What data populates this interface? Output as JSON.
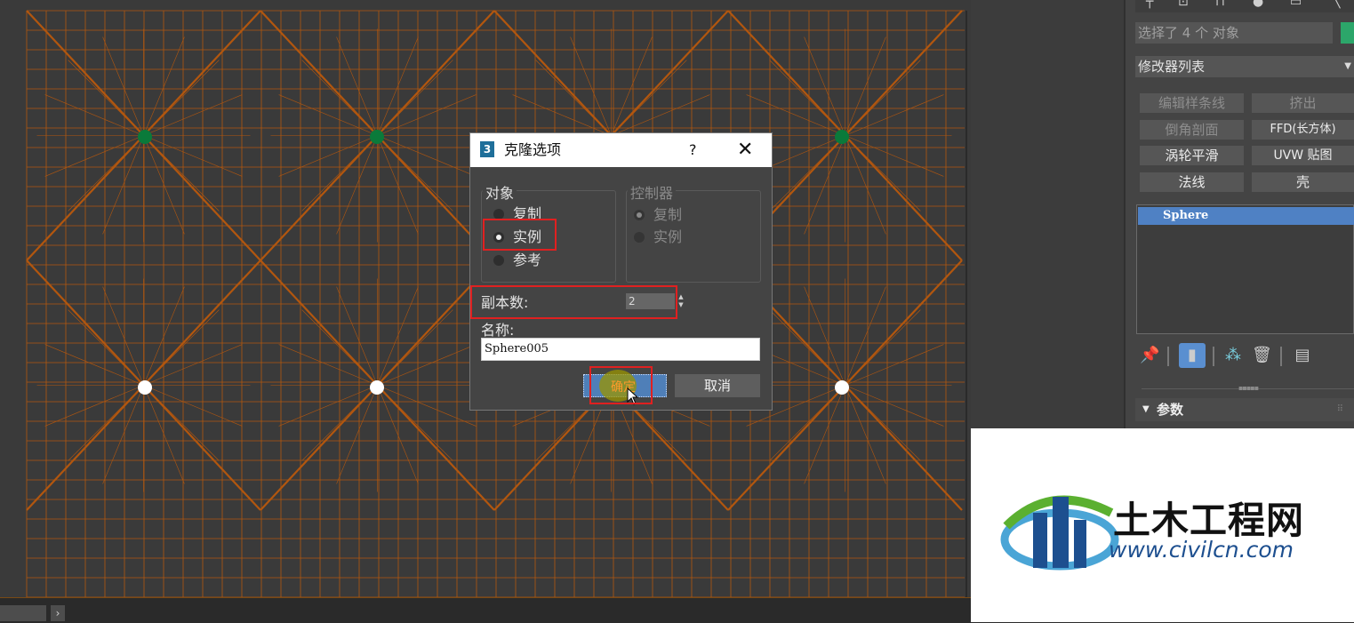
{
  "dialog": {
    "app_icon_text": "3",
    "title": "克隆选项",
    "help": "?",
    "close": "✕",
    "object_group": {
      "label": "对象",
      "options": [
        "复制",
        "实例",
        "参考"
      ],
      "selected": "实例"
    },
    "controller_group": {
      "label": "控制器",
      "options": [
        "复制",
        "实例"
      ],
      "selected": "复制"
    },
    "copies_label": "副本数:",
    "copies_value": "2",
    "name_label": "名称:",
    "name_value": "Sphere005",
    "ok_label": "确定",
    "cancel_label": "取消"
  },
  "panel": {
    "selection_text": "选择了 4 个 对象",
    "selection_color": "#2ca66a",
    "modifier_list": "修改器列表",
    "modifier_buttons": [
      "编辑样条线",
      "挤出",
      "倒角剖面",
      "FFD(长方体)",
      "涡轮平滑",
      "UVW 贴图",
      "法线",
      "壳"
    ],
    "stack_item": "Sphere",
    "rollout_title": "参数"
  },
  "toolbar_icons": [
    "pin-icon",
    "show-end-result-icon",
    "make-unique-icon",
    "remove-modifier-icon",
    "configure-modifier-sets-icon"
  ],
  "logo": {
    "brand": "土木工程网",
    "site": "www.civilcn.com"
  },
  "colors": {
    "wireframe": "#c05a0a",
    "selected_vertex": "#0a7a3a",
    "highlight": "#e02020"
  }
}
